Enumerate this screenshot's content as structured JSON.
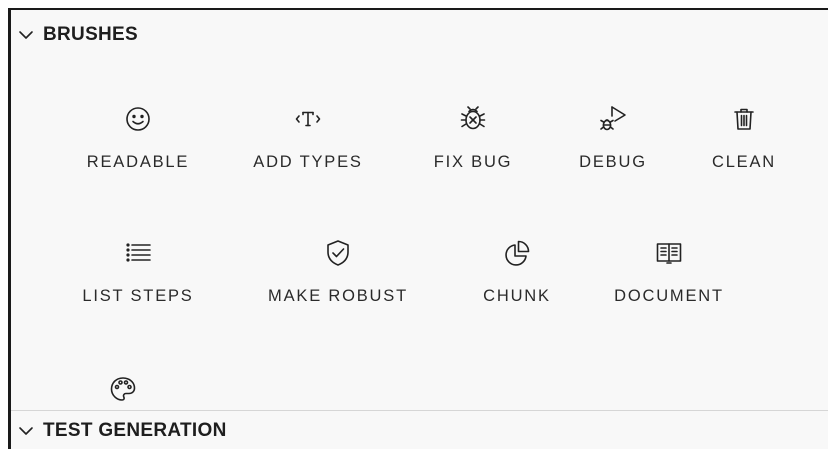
{
  "sections": {
    "brushes": {
      "title": "BRUSHES"
    },
    "test_generation": {
      "title": "TEST GENERATION"
    }
  },
  "brushes": [
    {
      "label": "READABLE",
      "icon": "smiley-icon"
    },
    {
      "label": "ADD TYPES",
      "icon": "type-brackets-icon"
    },
    {
      "label": "FIX BUG",
      "icon": "bug-x-icon"
    },
    {
      "label": "DEBUG",
      "icon": "bug-play-icon"
    },
    {
      "label": "CLEAN",
      "icon": "trash-icon"
    },
    {
      "label": "LIST STEPS",
      "icon": "list-icon"
    },
    {
      "label": "MAKE ROBUST",
      "icon": "shield-check-icon"
    },
    {
      "label": "CHUNK",
      "icon": "pie-chart-icon"
    },
    {
      "label": "DOCUMENT",
      "icon": "book-icon"
    },
    {
      "label": "",
      "icon": "palette-icon"
    }
  ]
}
